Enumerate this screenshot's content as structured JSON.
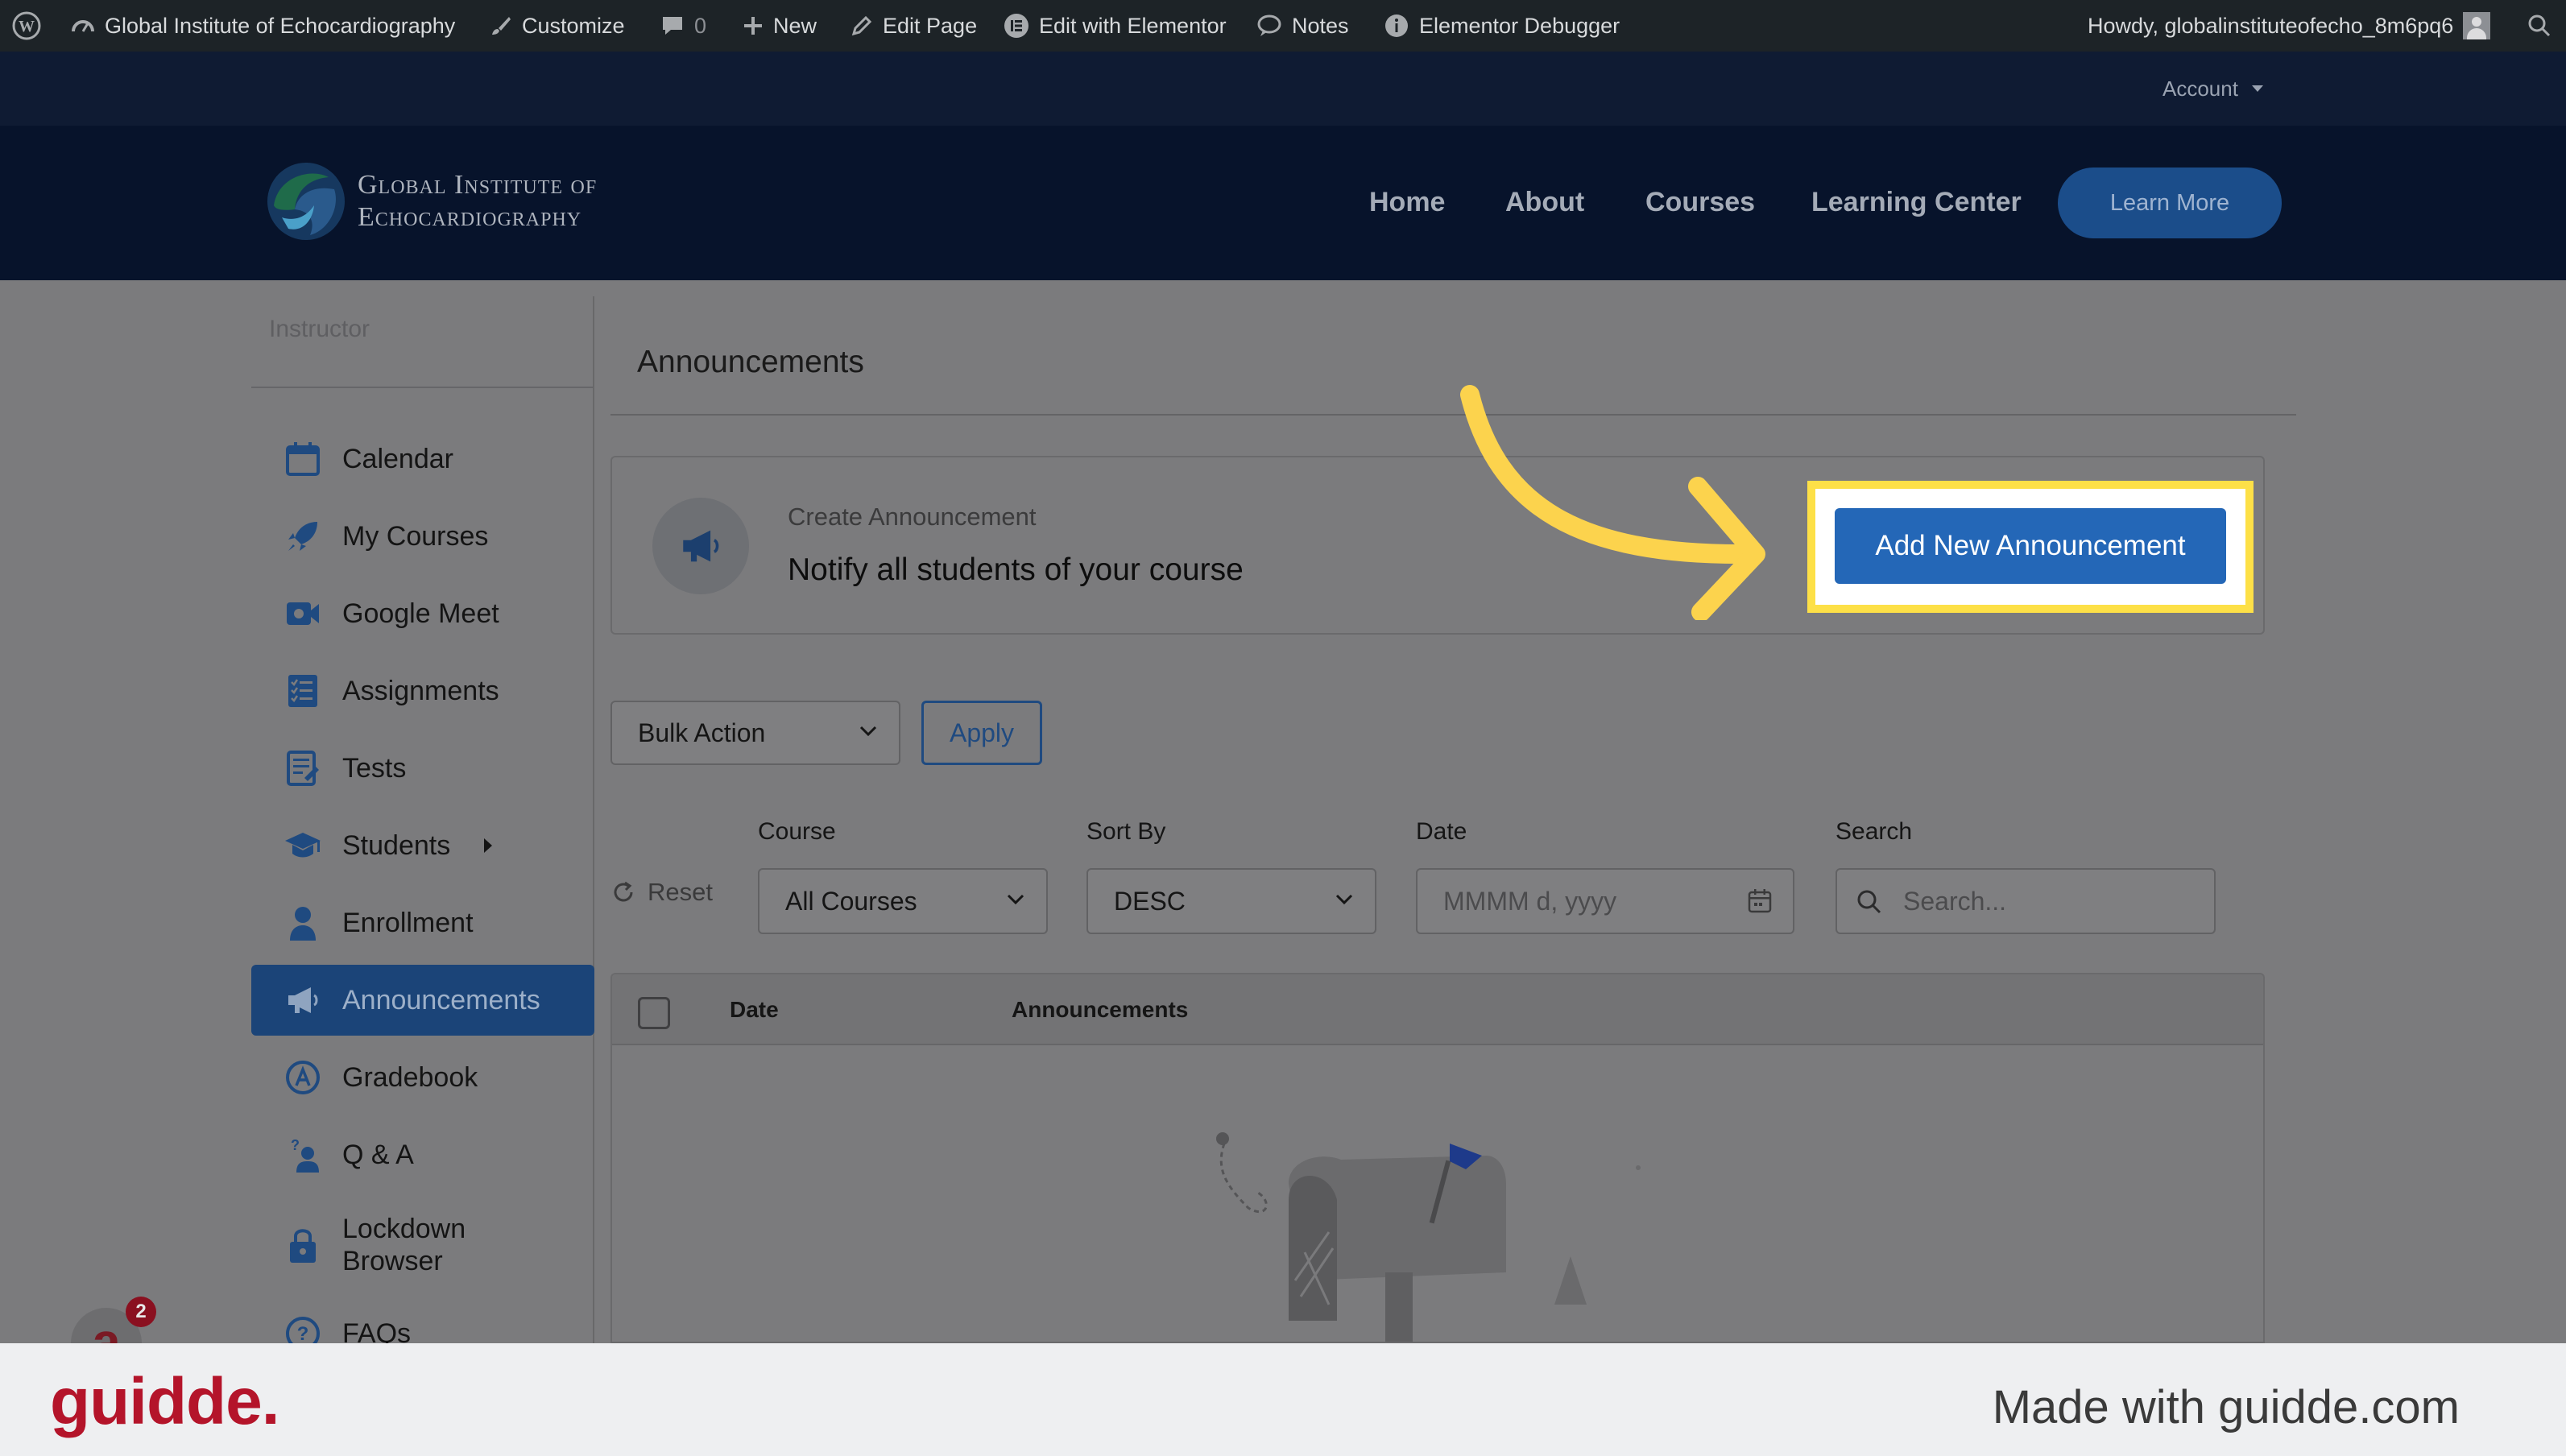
{
  "admin_bar": {
    "site_name": "Global Institute of Echocardiography",
    "customize": "Customize",
    "comments_count": "0",
    "new": "New",
    "edit_page": "Edit Page",
    "edit_with_elementor": "Edit with Elementor",
    "notes": "Notes",
    "debugger": "Elementor Debugger",
    "howdy": "Howdy, globalinstituteofecho_8m6pq6"
  },
  "account_bar": {
    "label": "Account"
  },
  "site_header": {
    "logo_line1": "Global Institute of",
    "logo_line2": "Echocardiography",
    "nav": [
      "Home",
      "About",
      "Courses",
      "Learning Center"
    ],
    "cta": "Learn More"
  },
  "sidebar": {
    "heading": "Instructor",
    "items": [
      {
        "label": "Calendar",
        "icon": "calendar-icon"
      },
      {
        "label": "My Courses",
        "icon": "rocket-icon"
      },
      {
        "label": "Google Meet",
        "icon": "video-camera-icon"
      },
      {
        "label": "Assignments",
        "icon": "checklist-icon"
      },
      {
        "label": "Tests",
        "icon": "quiz-icon"
      },
      {
        "label": "Students",
        "icon": "graduation-cap-icon",
        "has_submenu": true
      },
      {
        "label": "Enrollment",
        "icon": "user-icon"
      },
      {
        "label": "Announcements",
        "icon": "megaphone-icon",
        "active": true
      },
      {
        "label": "Gradebook",
        "icon": "grade-icon"
      },
      {
        "label": "Q & A",
        "icon": "question-answer-icon"
      },
      {
        "label": "Lockdown Browser",
        "icon": "lock-icon"
      },
      {
        "label": "FAQs",
        "icon": "help-circle-icon"
      }
    ]
  },
  "main": {
    "title": "Announcements",
    "create_card": {
      "subtitle": "Create Announcement",
      "title": "Notify all students of your course",
      "button": "Add New Announcement"
    },
    "bulk_action": {
      "selected": "Bulk Action",
      "apply": "Apply"
    },
    "filters": {
      "reset": "Reset",
      "course_label": "Course",
      "course_value": "All Courses",
      "sort_label": "Sort By",
      "sort_value": "DESC",
      "date_label": "Date",
      "date_placeholder": "MMMM d, yyyy",
      "search_label": "Search",
      "search_placeholder": "Search..."
    },
    "table": {
      "col_date": "Date",
      "col_announcements": "Announcements"
    }
  },
  "help_widget": {
    "badge_count": "2"
  },
  "footer": {
    "brand": "guidde.",
    "made_with": "Made with guidde.com"
  },
  "colors": {
    "highlight": "#fde047",
    "primary_button": "#2467b7",
    "active_sidebar": "#1b4478",
    "guidde_red": "#b4142a"
  }
}
